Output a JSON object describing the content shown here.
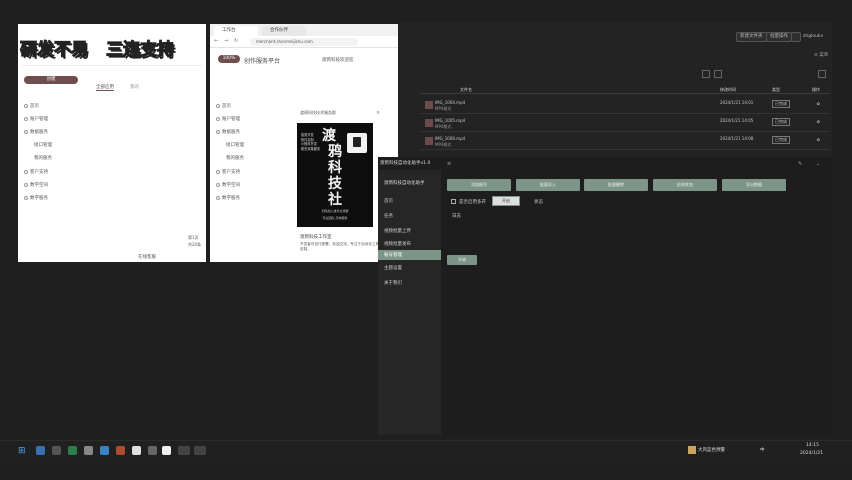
{
  "overlay": {
    "title_part1": "研发不易",
    "title_part2": "三连支持"
  },
  "background_panel": {
    "top_buttons": [
      "新建文件夹",
      "批量操作",
      "设置"
    ],
    "user": "zhgloukv",
    "header_cols": [
      "文件名",
      "修改时间",
      "类型",
      "操作"
    ],
    "rows": [
      {
        "name": "IMG_1004.mp4",
        "sub": "MP4格式",
        "time": "2024/1/21 14:01",
        "tag": "已完成"
      },
      {
        "name": "IMG_1005.mp4",
        "sub": "MP4格式",
        "time": "2024/1/21 14:05",
        "tag": "已完成"
      },
      {
        "name": "IMG_1006.mp4",
        "sub": "MP4格式",
        "time": "2024/1/21 14:08",
        "tag": "已完成"
      }
    ]
  },
  "browser_left": {
    "tab": "工作台",
    "primary_button": "创建",
    "tabs": [
      "全部应用",
      "我的"
    ],
    "nav": [
      "首页",
      "账户管理",
      "数据服务",
      "接口管理",
      "我的服务",
      "客户支持",
      "数字空间",
      "数字服务"
    ],
    "footer_a": "第1页",
    "footer_b": "共20条",
    "footer_c": "在线客服"
  },
  "browser_right": {
    "tab_a": "工作台",
    "tab_b": "合作伙伴",
    "url": "merchant.shenmeijishu.com",
    "badge": "100%",
    "header": "创作服务平台",
    "header_right": "渡鸦科技欢迎您",
    "nav": [
      "首页",
      "账户管理",
      "数据服务",
      "接口管理",
      "我的服务",
      "客户支持",
      "数字空间",
      "数字服务"
    ],
    "poster": {
      "top_text": "渡鸦科技技术服务群",
      "chars": [
        "渡",
        "鸦",
        "科",
        "技",
        "社"
      ],
      "list": [
        "各类开发",
        "软件定制",
        "小程序开发",
        "爬虫采集服务"
      ],
      "bottom_a": "扫码加入技术交流群",
      "bottom_b": "专业团队 高效服务"
    },
    "caption": "渡鸦科技工作室",
    "desc": "开发者可自行部署，欢迎交流。专注于自动化工具开发与定制。"
  },
  "dialog": {
    "title": "渡鸦科技自动化助手v1.0",
    "side_header": "渡鸦科技自动化助手",
    "side_items": [
      "首页",
      "任务",
      "视频批量上传",
      "视频批量发布",
      "账号管理",
      "主题设置",
      "关于我们"
    ],
    "active_side": "账号管理",
    "action_buttons": [
      "添加账号",
      "批量导入",
      "批量删除",
      "检测状态",
      "导出数据"
    ],
    "option_label": "是否启用多开",
    "option_value": "开启",
    "option_extra": "状态",
    "log_label": "日志",
    "start_button": "开始"
  },
  "taskbar": {
    "weather": "大风蓝色预警",
    "time": "14:15",
    "date": "2024/1/21",
    "lang": "中"
  },
  "colors": {
    "accent_brown": "#6f4e4e",
    "accent_green": "#7d9488"
  }
}
